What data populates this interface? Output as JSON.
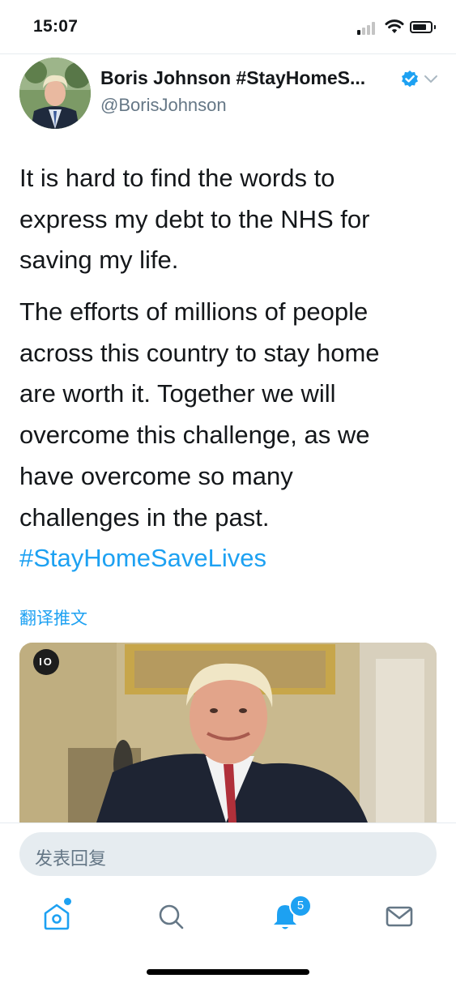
{
  "status": {
    "time": "15:07"
  },
  "author": {
    "display_name": "Boris Johnson #StayHomeS...",
    "handle": "@BorisJohnson",
    "verified": true
  },
  "tweet": {
    "paragraph1_lines": [
      "It is hard to find the words to",
      "express my debt to the NHS for",
      "saving my life."
    ],
    "paragraph2_lines": [
      "The efforts of millions of people",
      "across this country to stay home",
      "are worth it. Together we will",
      "overcome this challenge, as we",
      "have overcome so many",
      "challenges in the past."
    ],
    "hashtag": "#StayHomeSaveLives",
    "translate_label": "翻译推文"
  },
  "media": {
    "badge": "IO"
  },
  "reply": {
    "placeholder": "发表回复"
  },
  "tabbar": {
    "items": [
      {
        "name": "home-icon"
      },
      {
        "name": "search-icon"
      },
      {
        "name": "bell-icon"
      },
      {
        "name": "mail-icon"
      }
    ],
    "notification_count": "5"
  },
  "colors": {
    "accent": "#1da1f2",
    "muted": "#657786",
    "text": "#14171a"
  }
}
